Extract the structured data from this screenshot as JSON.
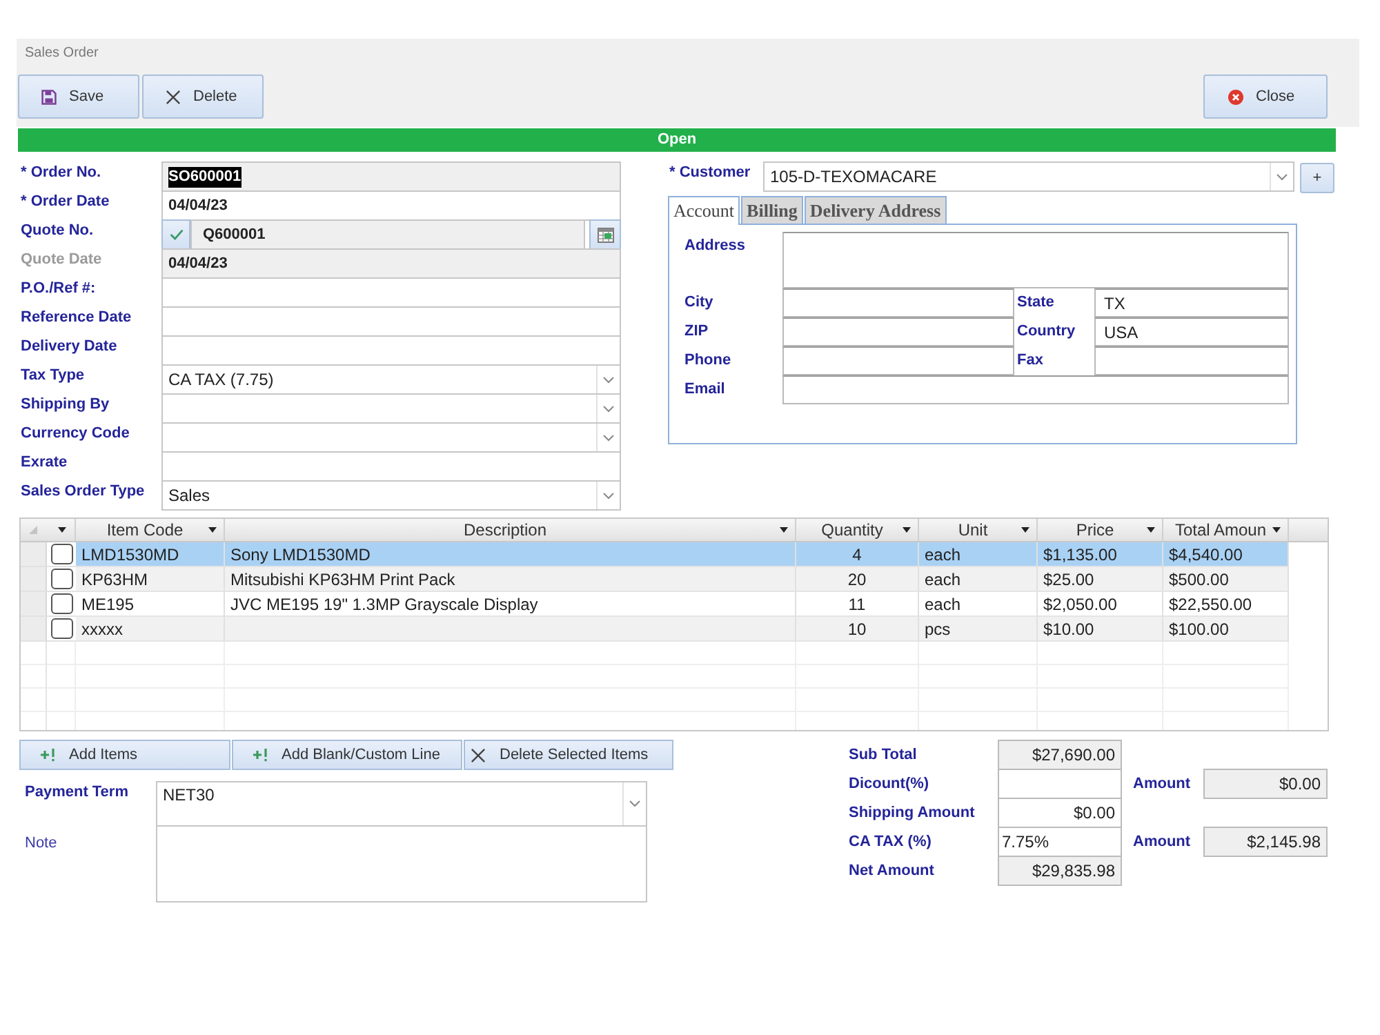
{
  "window": {
    "title": "Sales Order"
  },
  "toolbar": {
    "left": [
      {
        "label": "Save",
        "kind": "save"
      },
      {
        "label": "Delete",
        "kind": "delete"
      }
    ],
    "right": [
      {
        "label": "Close",
        "kind": "close"
      }
    ]
  },
  "status_bar": {
    "label": "Open"
  },
  "order_fields": [
    {
      "label": "* Order No.",
      "kind": "text",
      "value": "SO600001",
      "readonly": true,
      "disabled": false,
      "text_selected": true
    },
    {
      "label": "* Order Date",
      "kind": "text",
      "value": "04/04/23",
      "readonly": false,
      "disabled": false,
      "text_selected": false
    },
    {
      "label": "Quote No.",
      "kind": "lookup",
      "value": "Q600001",
      "readonly": true,
      "disabled": false,
      "text_selected": false
    },
    {
      "label": "Quote Date",
      "kind": "text",
      "value": "04/04/23",
      "readonly": true,
      "disabled": true,
      "text_selected": false
    },
    {
      "label": "P.O./Ref #:",
      "kind": "text",
      "readonly": false,
      "disabled": false
    },
    {
      "label": "Reference Date",
      "kind": "text",
      "readonly": false,
      "disabled": false
    },
    {
      "label": "Delivery Date",
      "kind": "text",
      "readonly": false,
      "disabled": false
    },
    {
      "label": "Tax Type",
      "kind": "dropdown",
      "value": "CA TAX (7.75)",
      "readonly": false,
      "disabled": false,
      "text_selected": false
    },
    {
      "label": "Shipping By",
      "kind": "dropdown",
      "readonly": false,
      "disabled": false
    },
    {
      "label": "Currency Code",
      "kind": "dropdown",
      "readonly": false,
      "disabled": false
    },
    {
      "label": "Exrate",
      "kind": "text",
      "readonly": false,
      "disabled": false
    },
    {
      "label": "Sales Order Type",
      "kind": "dropdown",
      "value": "Sales",
      "readonly": false,
      "disabled": false,
      "text_selected": false
    }
  ],
  "customer": {
    "label": "* Customer",
    "value": "105-D-TEXOMACARE",
    "add_button": "+"
  },
  "customer_tabs": [
    {
      "label": "Account",
      "selected": true
    },
    {
      "label": "Billing",
      "selected": false
    },
    {
      "label": "Delivery Address",
      "selected": false
    }
  ],
  "account": {
    "address": {
      "label": "Address"
    },
    "rows": [
      {
        "left": {
          "label": "City"
        },
        "right": {
          "label": "State",
          "value": "TX"
        }
      },
      {
        "left": {
          "label": "ZIP"
        },
        "right": {
          "label": "Country",
          "value": "USA"
        }
      },
      {
        "left": {
          "label": "Phone"
        },
        "right": {
          "label": "Fax"
        }
      }
    ],
    "email": {
      "label": "Email"
    }
  },
  "items_table": {
    "columns": [
      {
        "label": "Item Code"
      },
      {
        "label": "Description"
      },
      {
        "label": "Quantity"
      },
      {
        "label": "Unit"
      },
      {
        "label": "Price"
      },
      {
        "label": "Total Amoun"
      }
    ],
    "rows": [
      {
        "selected": true,
        "checked": false,
        "cells": [
          "LMD1530MD",
          "Sony LMD1530MD",
          "4",
          "each",
          "$1,135.00",
          "$4,540.00"
        ]
      },
      {
        "selected": false,
        "checked": false,
        "cells": [
          "KP63HM",
          "Mitsubishi KP63HM Print Pack",
          "20",
          "each",
          "$25.00",
          "$500.00"
        ]
      },
      {
        "selected": false,
        "checked": false,
        "cells": [
          "ME195",
          "JVC ME195 19\" 1.3MP Grayscale Display",
          "11",
          "each",
          "$2,050.00",
          "$22,550.00"
        ]
      },
      {
        "selected": false,
        "checked": false,
        "cells": [
          "xxxxx",
          null,
          "10",
          "pcs",
          "$10.00",
          "$100.00"
        ]
      }
    ]
  },
  "item_buttons": [
    {
      "label": "Add Items",
      "kind": "add"
    },
    {
      "label": "Add Blank/Custom Line",
      "kind": "add"
    },
    {
      "label": "Delete Selected Items",
      "kind": "delete"
    }
  ],
  "payment_term": {
    "label": "Payment Term",
    "value": "NET30"
  },
  "note": {
    "label": "Note"
  },
  "totals": [
    {
      "label": "Sub Total",
      "kind": "money",
      "value": "$27,690.00",
      "readonly": true
    },
    {
      "label": "Dicount(%)",
      "kind": "percent",
      "readonly": false,
      "amount": {
        "label": "Amount",
        "value": "$0.00",
        "readonly": true
      }
    },
    {
      "label": "Shipping Amount",
      "kind": "money",
      "value": "$0.00",
      "readonly": false
    },
    {
      "label": "CA TAX (%)",
      "kind": "percent",
      "value": "7.75%",
      "readonly": false,
      "amount": {
        "label": "Amount",
        "value": "$2,145.98",
        "readonly": true
      }
    },
    {
      "label": "Net Amount",
      "kind": "money",
      "value": "$29,835.98",
      "readonly": true
    }
  ]
}
